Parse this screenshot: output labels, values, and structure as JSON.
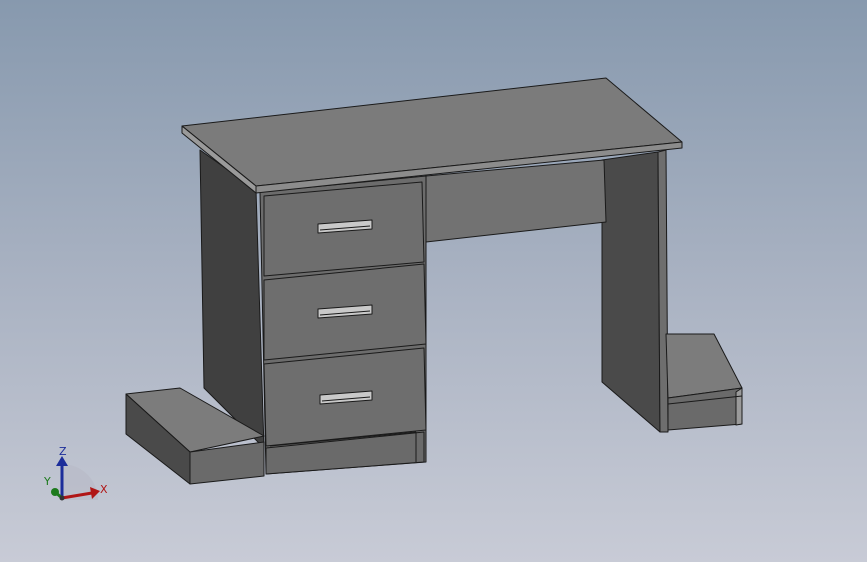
{
  "viewport": {
    "background_top": "#8799ae",
    "background_bottom": "#c8cbd6"
  },
  "model": {
    "description_icon": "desk-model",
    "colors": {
      "top_surface": "#7b7b7b",
      "front_face": "#6a6a6a",
      "dark_side": "#404040",
      "edge_line": "#1a1a1a",
      "handle": "#c9c9c9"
    }
  },
  "triad": {
    "z_label": "Z",
    "y_label": "Y",
    "x_label": "X",
    "z_color": "#1c2d9a",
    "y_color": "#1d7a1d",
    "x_color": "#b01515"
  }
}
